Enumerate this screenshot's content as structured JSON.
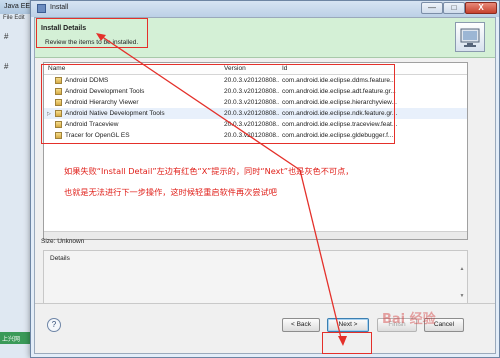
{
  "background_app": {
    "title": "Java EE",
    "menu": "File Edit",
    "toolbar_glyph_1": "#",
    "toolbar_glyph_2": "#",
    "status_badge": "上兴网"
  },
  "window": {
    "title": "Install",
    "buttons": {
      "minimize": "—",
      "maximize": "□",
      "close": "X"
    }
  },
  "header": {
    "title": "Install Details",
    "subtitle": "Review the items to be installed."
  },
  "table": {
    "columns": {
      "name": "Name",
      "version": "Version",
      "id": "Id"
    },
    "rows": [
      {
        "expand": "",
        "name": "Android DDMS",
        "version": "20.0.3.v20120808...",
        "id": "com.android.ide.eclipse.ddms.feature...",
        "selected": false
      },
      {
        "expand": "",
        "name": "Android Development Tools",
        "version": "20.0.3.v20120808...",
        "id": "com.android.ide.eclipse.adt.feature.gr...",
        "selected": false
      },
      {
        "expand": "",
        "name": "Android Hierarchy Viewer",
        "version": "20.0.3.v20120808...",
        "id": "com.android.ide.eclipse.hierarchyview...",
        "selected": false
      },
      {
        "expand": "▷",
        "name": "Android Native Development Tools",
        "version": "20.0.3.v20120808...",
        "id": "com.android.ide.eclipse.ndk.feature.gr...",
        "selected": true
      },
      {
        "expand": "",
        "name": "Android Traceview",
        "version": "20.0.3.v20120808...",
        "id": "com.android.ide.eclipse.traceview.feat...",
        "selected": false
      },
      {
        "expand": "",
        "name": "Tracer for OpenGL ES",
        "version": "20.0.3.v20120808...",
        "id": "com.android.ide.eclipse.gldebugger.f...",
        "selected": false
      }
    ]
  },
  "size_label": "Size: Unknown",
  "details": {
    "label": "Details",
    "scroll_up": "▲",
    "scroll_down": "▼"
  },
  "footer": {
    "help": "?",
    "back": "< Back",
    "next": "Next >",
    "finish": "Finish",
    "cancel": "Cancel"
  },
  "annotation": {
    "line1": "如果失败“Install Detail”左边有红色“X”提示的，同时“Next”也是灰色不可点，",
    "line2": "也就是无法进行下一步操作，这时候轻重启软件再次尝试吧",
    "color": "#e4302a"
  },
  "watermark": "Bai 经验"
}
